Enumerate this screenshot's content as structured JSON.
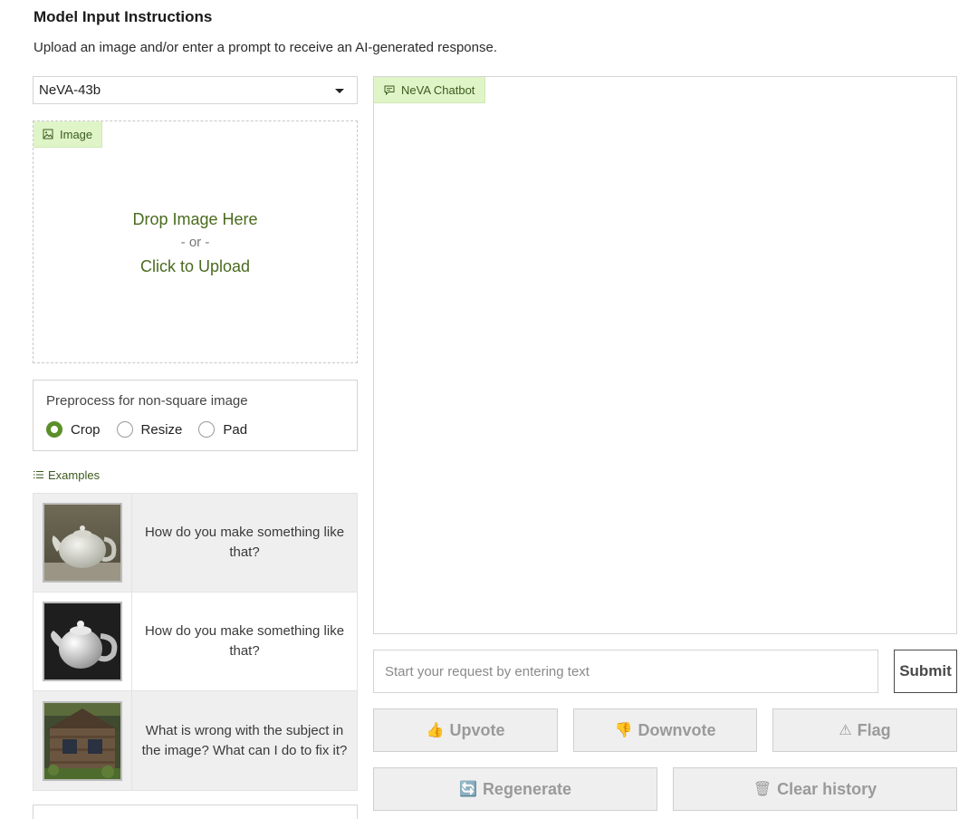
{
  "header": {
    "title": "Model Input Instructions",
    "subtitle": "Upload an image and/or enter a prompt to receive an AI-generated response."
  },
  "model_select": {
    "value": "NeVA-43b"
  },
  "image_upload": {
    "tag": "Image",
    "drop_text": "Drop Image Here",
    "or_text": "- or -",
    "click_text": "Click to Upload"
  },
  "preprocess": {
    "label": "Preprocess for non-square image",
    "options": [
      "Crop",
      "Resize",
      "Pad"
    ],
    "selected": "Crop"
  },
  "examples": {
    "header": "Examples",
    "items": [
      {
        "text": "How do you make something like that?",
        "thumb": "teapot-light"
      },
      {
        "text": "How do you make something like that?",
        "thumb": "teapot-dark"
      },
      {
        "text": "What is wrong with the subject in the image? What can I do to fix it?",
        "thumb": "old-cabin"
      }
    ]
  },
  "chatbot": {
    "tag": "NeVA Chatbot"
  },
  "prompt": {
    "placeholder": "Start your request by entering text",
    "submit_label": "Submit"
  },
  "actions": {
    "upvote": "Upvote",
    "downvote": "Downvote",
    "flag": "Flag",
    "regenerate": "Regenerate",
    "clear_history": "Clear history"
  },
  "colors": {
    "accent_green": "#5a8f29",
    "tag_bg": "#dff5c8",
    "tag_text": "#3c5a1e"
  }
}
